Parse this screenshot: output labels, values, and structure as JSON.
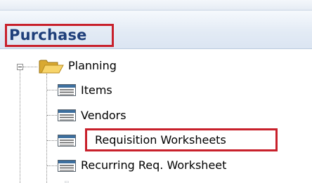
{
  "panel": {
    "title": "Purchase"
  },
  "tree": {
    "folder": {
      "label": "Planning",
      "icon": "folder-open-icon",
      "expanded": true
    },
    "items": [
      {
        "label": "Items",
        "icon": "list-icon"
      },
      {
        "label": "Vendors",
        "icon": "list-icon"
      },
      {
        "label": "Requisition Worksheets",
        "icon": "list-icon",
        "highlighted": true
      },
      {
        "label": "Recurring Req. Worksheet",
        "icon": "list-icon"
      }
    ]
  },
  "colors": {
    "highlight_border": "#c8202b",
    "title_text": "#1f3f7a",
    "header_bg": "#e3ebf5"
  }
}
